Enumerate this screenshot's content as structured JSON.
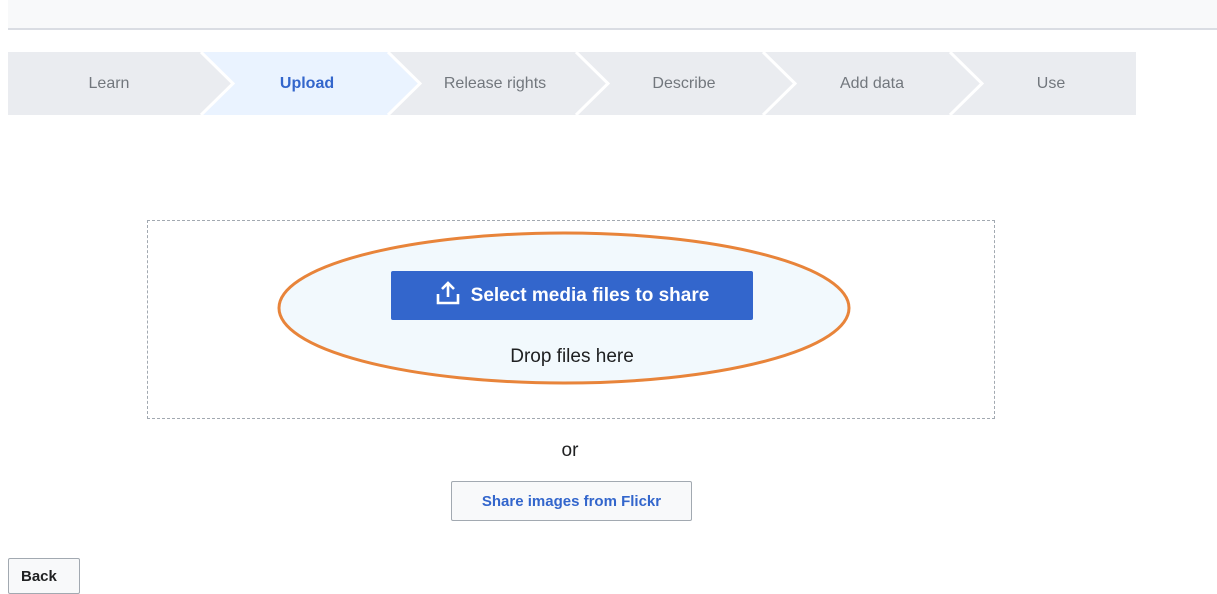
{
  "steps": [
    {
      "label": "Learn",
      "active": false
    },
    {
      "label": "Upload",
      "active": true
    },
    {
      "label": "Release rights",
      "active": false
    },
    {
      "label": "Describe",
      "active": false
    },
    {
      "label": "Add data",
      "active": false
    },
    {
      "label": "Use",
      "active": false
    }
  ],
  "upload": {
    "select_label": "Select media files to share",
    "select_icon": "upload-icon",
    "drop_text": "Drop files here",
    "or_text": "or",
    "flickr_label": "Share images from Flickr"
  },
  "footer": {
    "back_label": "Back"
  },
  "colors": {
    "accent": "#3366cc",
    "active_step_bg": "#eaf3ff",
    "highlight": "#e8843a"
  }
}
